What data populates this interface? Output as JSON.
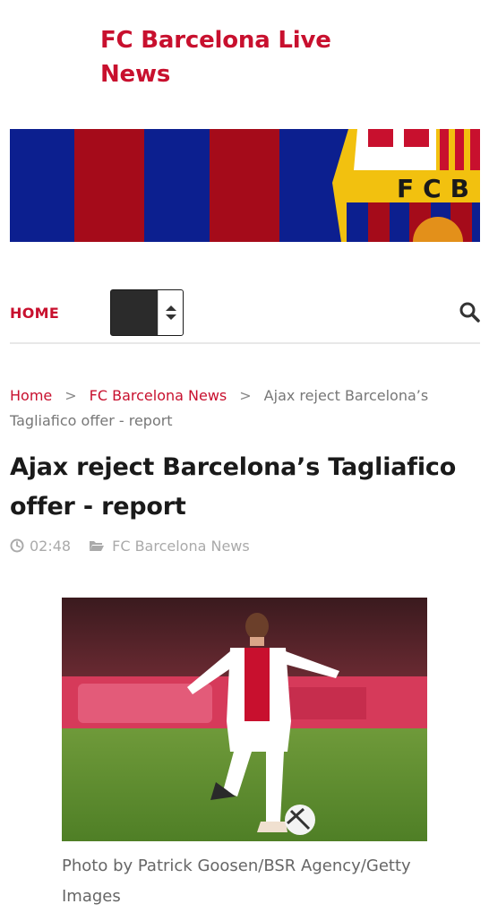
{
  "site": {
    "title": "FC Barcelona Live News"
  },
  "banner": {
    "crest_text": "FCB",
    "colors": {
      "blue": "#0c1f8f",
      "red": "#a50b1a",
      "gold": "#f2c10f"
    }
  },
  "nav": {
    "home_label": "HOME",
    "select_value": "",
    "search_icon": "search-icon"
  },
  "breadcrumb": {
    "items": [
      "Home",
      "FC Barcelona News",
      "Ajax reject Barcelona’s Tagliafico offer - report"
    ],
    "separator": ">"
  },
  "article": {
    "title": "Ajax reject Barcelona’s Tagliafico offer - report",
    "time": "02:48",
    "category": "FC Barcelona News",
    "image_caption": "Photo by Patrick Goosen/BSR Agency/Getty Images"
  },
  "theme": {
    "accent": "#c8102e",
    "meta_gray": "#aaaaaa"
  }
}
